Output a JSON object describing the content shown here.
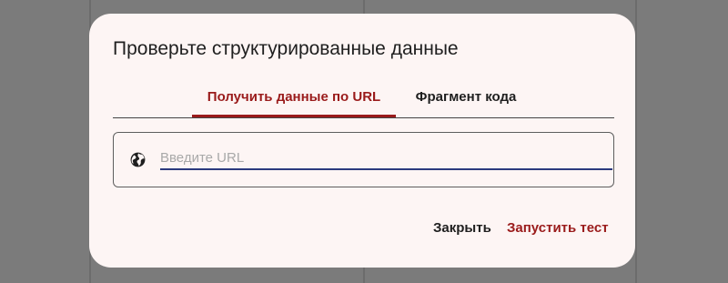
{
  "dialog": {
    "title": "Проверьте структурированные данные",
    "tabs": [
      {
        "label": "Получить данные по URL",
        "active": true
      },
      {
        "label": "Фрагмент кода",
        "active": false
      }
    ],
    "url_input": {
      "placeholder": "Введите URL",
      "value": ""
    },
    "icon": "globe-icon",
    "actions": {
      "close_label": "Закрыть",
      "run_label": "Запустить тест"
    }
  },
  "colors": {
    "accent": "#9a1b1b",
    "dialog_background": "#fdf5f4",
    "backdrop": "#7b7b7b",
    "input_underline": "#2c3a7e"
  }
}
